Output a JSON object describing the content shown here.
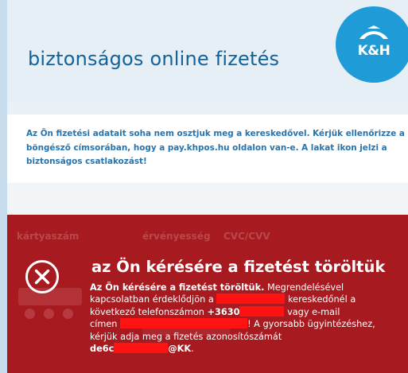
{
  "header": {
    "title": "biztonságos online fizetés",
    "logo_text": "K&H",
    "logo_icon": "kh-logo-icon"
  },
  "notice": {
    "text": "Az Ön fizetési adatait soha nem osztjuk meg a kereskedővel. Kérjük ellenőrizze a böngésző címsorában, hogy a pay.khpos.hu oldalon van-e. A lakat ikon jelzi a biztonságos csatlakozást!"
  },
  "form": {
    "card_number_label": "kártyaszám",
    "expiry_label": "érvényesség",
    "cvc_label": "CVC/CVV"
  },
  "error": {
    "icon": "cross-circle-icon",
    "title": "az Ön kérésére a fizetést töröltük",
    "body_bold_intro": "Az Ön kérésére a fizetést töröltük.",
    "body_line1_rest": " Megrendelésével",
    "body_line2_start": "kapcsolatban érdeklődjön a ",
    "body_line2_end": " kereskedőnél a",
    "body_line3_start": "következő telefonszámon ",
    "body_phone_prefix": "+3630",
    "body_line3_end": " vagy e-mail",
    "body_line4_start": "címen ",
    "body_line4_end": "! A gyorsabb ügyintézéshez,",
    "body_line5": "kérjük adja meg a fizetés azonosítószámát",
    "body_id_prefix": "de6c",
    "body_id_suffix": "@KK",
    "body_id_end": "."
  },
  "colors": {
    "brand_blue": "#14629a",
    "logo_blue": "#1f9bd7",
    "error_red": "#a61a20",
    "redaction": "#ff1212"
  }
}
